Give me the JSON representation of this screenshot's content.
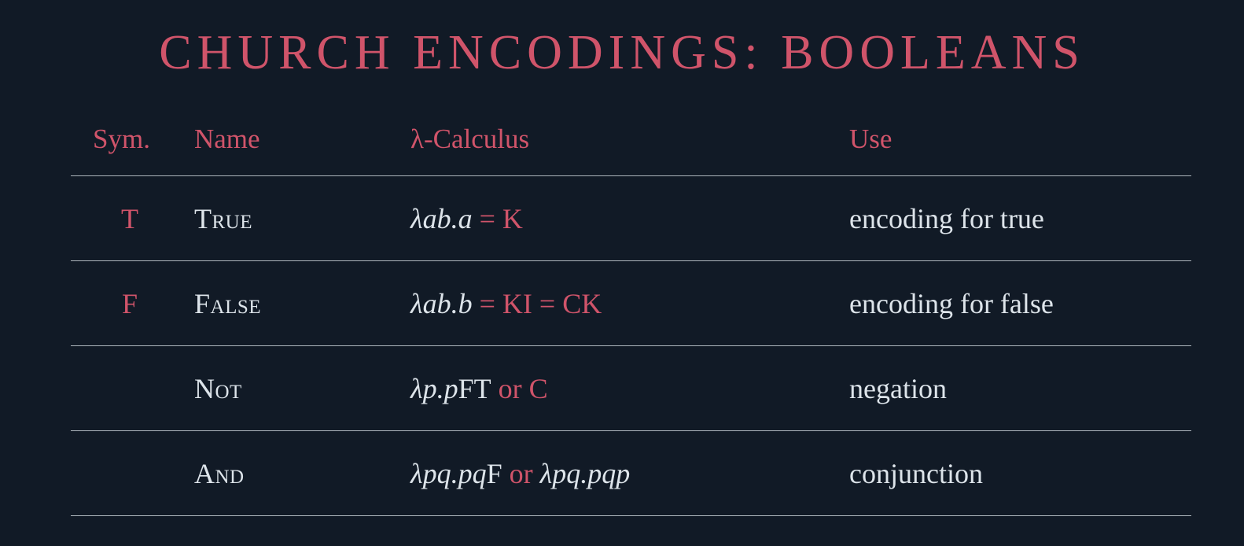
{
  "title": "CHURCH ENCODINGS: BOOLEANS",
  "headers": {
    "sym": "Sym.",
    "name": "Name",
    "lambda": "λ-Calculus",
    "use": "Use"
  },
  "rows": [
    {
      "sym": "T",
      "name": "True",
      "lambda": [
        {
          "t": "λab.a",
          "style": "it"
        },
        {
          "t": " = ",
          "style": "red"
        },
        {
          "t": "K",
          "style": "red"
        }
      ],
      "use": "encoding for true"
    },
    {
      "sym": "F",
      "name": "False",
      "lambda": [
        {
          "t": "λab.b",
          "style": "it"
        },
        {
          "t": " = ",
          "style": "red"
        },
        {
          "t": "KI",
          "style": "red"
        },
        {
          "t": " = ",
          "style": "red"
        },
        {
          "t": "CK",
          "style": "red"
        }
      ],
      "use": "encoding for false"
    },
    {
      "sym": "",
      "name": "Not",
      "lambda": [
        {
          "t": "λp.p",
          "style": "it"
        },
        {
          "t": "FT",
          "style": "plain"
        },
        {
          "t": " or ",
          "style": "red"
        },
        {
          "t": "C",
          "style": "red"
        }
      ],
      "use": "negation"
    },
    {
      "sym": "",
      "name": "And",
      "lambda": [
        {
          "t": "λpq.pq",
          "style": "it"
        },
        {
          "t": "F",
          "style": "plain"
        },
        {
          "t": " or ",
          "style": "red"
        },
        {
          "t": "λpq.pqp",
          "style": "it"
        }
      ],
      "use": "conjunction"
    }
  ],
  "colors": {
    "background": "#111a26",
    "accent": "#d0546a",
    "text": "#dde4ea",
    "rule": "#aeb6bd"
  }
}
